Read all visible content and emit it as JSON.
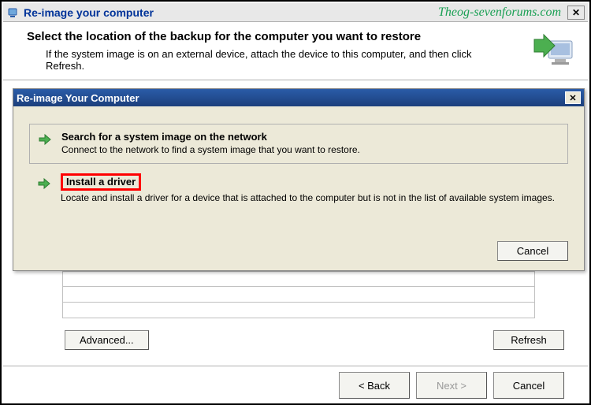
{
  "watermark": "Theog-sevenforums.com",
  "outer": {
    "title": "Re-image your computer",
    "heading": "Select the location of the backup for the computer you want to restore",
    "description": "If the system image is on an external device, attach the device to this computer, and then click Refresh."
  },
  "dialog": {
    "title": "Re-image Your Computer",
    "option1": {
      "title": "Search for a system image on the network",
      "desc": "Connect to the network to find a system image that you want to restore."
    },
    "option2": {
      "title": "Install a driver",
      "desc": "Locate and install a driver for a device that is attached to the computer but is not in the list of available system images."
    },
    "cancel": "Cancel"
  },
  "buttons": {
    "advanced": "Advanced...",
    "refresh": "Refresh",
    "back": "< Back",
    "next": "Next >",
    "cancel": "Cancel"
  }
}
